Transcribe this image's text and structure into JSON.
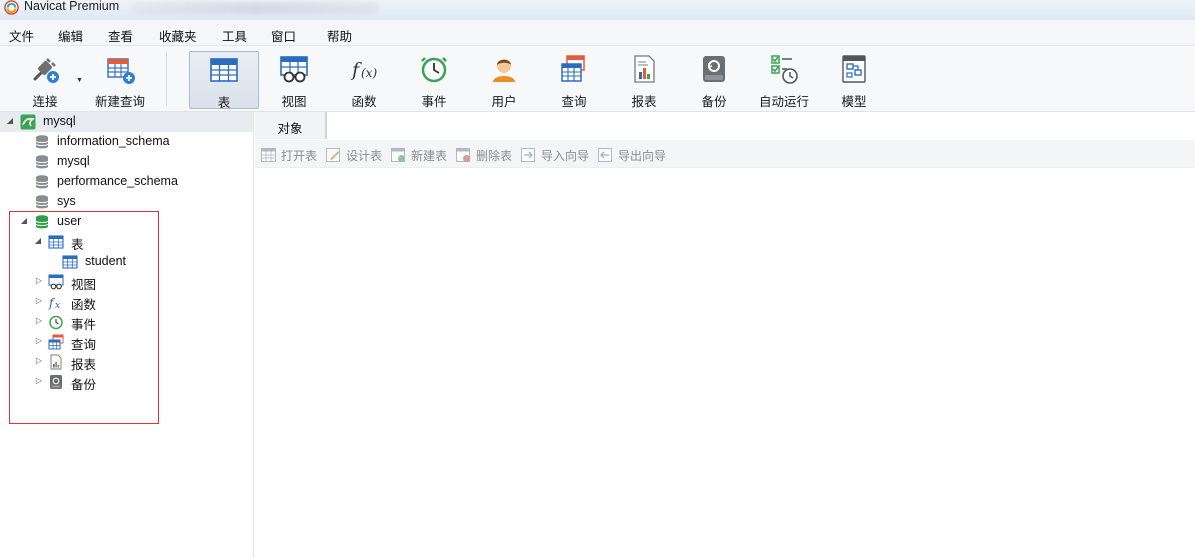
{
  "window": {
    "title": "Navicat Premium"
  },
  "menu": [
    "文件",
    "编辑",
    "查看",
    "收藏夹",
    "工具",
    "窗口",
    "帮助"
  ],
  "toolbar": {
    "connect": "连接",
    "new_query": "新建查询",
    "table": "表",
    "view": "视图",
    "function": "函数",
    "event": "事件",
    "user": "用户",
    "query": "查询",
    "report": "报表",
    "backup": "备份",
    "automation": "自动运行",
    "model": "模型"
  },
  "tree": {
    "connection": "mysql",
    "databases": [
      "information_schema",
      "mysql",
      "performance_schema",
      "sys",
      "user"
    ],
    "user_children": {
      "tables": "表",
      "student": "student",
      "views": "视图",
      "functions": "函数",
      "events": "事件",
      "queries": "查询",
      "reports": "报表",
      "backups": "备份"
    }
  },
  "tabs": {
    "objects": "对象"
  },
  "object_toolbar": {
    "open_table": "打开表",
    "design_table": "设计表",
    "new_table": "新建表",
    "delete_table": "删除表",
    "import_wizard": "导入向导",
    "export_wizard": "导出向导"
  },
  "colors": {
    "highlight_box": "#e0343a",
    "active_tab_bg": "#d9e1ea"
  }
}
